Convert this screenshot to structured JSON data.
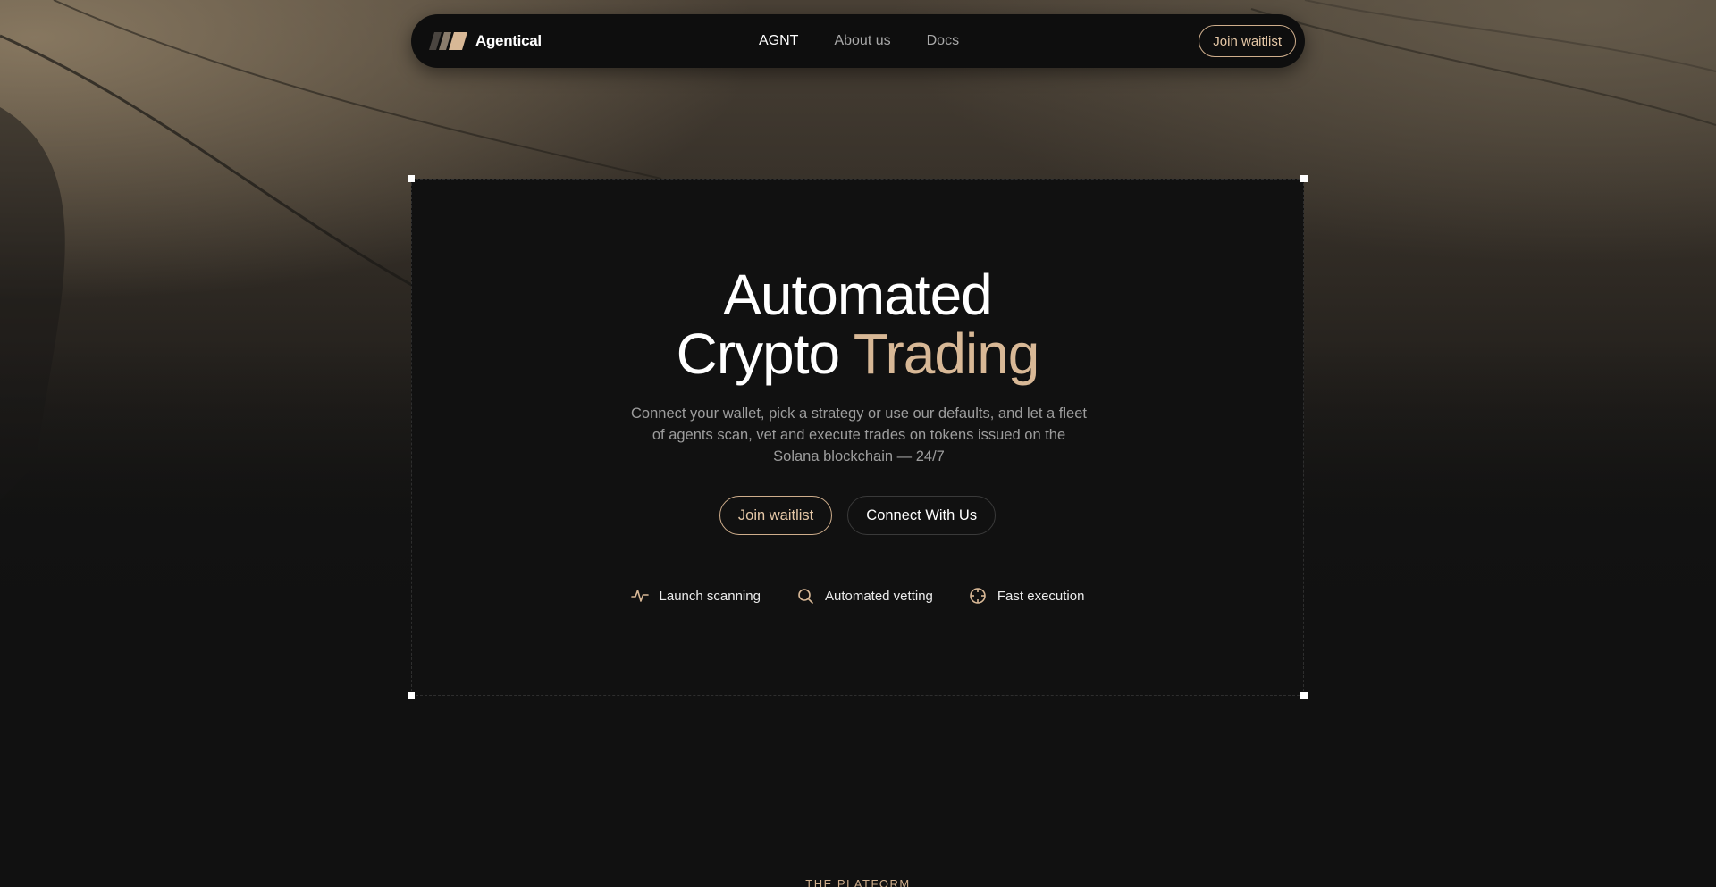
{
  "brand": {
    "name": "Agentical",
    "icon": "brand-logo-icon"
  },
  "nav": {
    "links": [
      {
        "label": "AGNT",
        "active": true
      },
      {
        "label": "About us",
        "active": false
      },
      {
        "label": "Docs",
        "active": false
      }
    ],
    "cta_label": "Join waitlist"
  },
  "hero": {
    "title_line1": "Automated",
    "title_line2_part1": "Crypto ",
    "title_line2_accent": "Trading",
    "description": "Connect your wallet, pick a strategy or use our defaults, and let a fleet of agents scan, vet and execute trades on tokens issued on the Solana blockchain — 24/7",
    "primary_cta": "Join waitlist",
    "secondary_cta": "Connect With Us",
    "features": [
      {
        "label": "Launch scanning",
        "icon": "pulse-icon"
      },
      {
        "label": "Automated vetting",
        "icon": "search-icon"
      },
      {
        "label": "Fast execution",
        "icon": "crosshair-icon"
      }
    ]
  },
  "next_section": {
    "label": "THE PLATFORM"
  },
  "colors": {
    "background": "#111111",
    "accent": "#d8b896",
    "accent_border": "#cfae8c",
    "muted_text": "#9d9d9d"
  }
}
